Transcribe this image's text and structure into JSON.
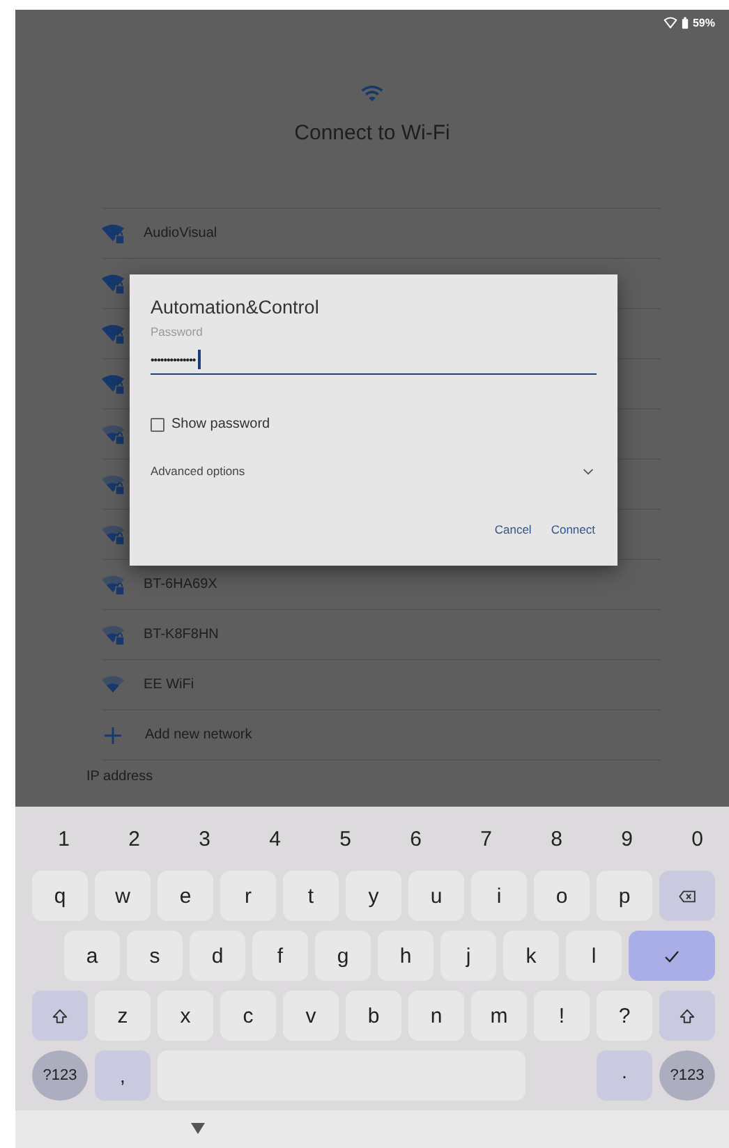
{
  "status_bar": {
    "battery": "59%"
  },
  "page": {
    "title": "Connect to Wi-Fi"
  },
  "networks": [
    {
      "name": "AudioVisual",
      "secured": true,
      "kind": "strong"
    },
    {
      "secured": true,
      "kind": "strong"
    },
    {
      "secured": true,
      "kind": "strong"
    },
    {
      "secured": true,
      "kind": "strong"
    },
    {
      "secured": true,
      "kind": "weak"
    },
    {
      "secured": true,
      "kind": "weak"
    },
    {
      "secured": true,
      "kind": "weak"
    },
    {
      "name": "BT-6HA69X",
      "secured": true,
      "kind": "weak"
    },
    {
      "name": "BT-K8F8HN",
      "secured": true,
      "kind": "weak"
    },
    {
      "name": "EE WiFi",
      "secured": false,
      "kind": "weak"
    }
  ],
  "add_network": "Add new network",
  "ip_address": "IP address",
  "dialog": {
    "title": "Automation&Control",
    "password_label": "Password",
    "password_value": "••••••••••••••",
    "show_password": {
      "label": "Show password",
      "checked": false
    },
    "advanced_options": {
      "label": "Advanced options",
      "expanded": false
    },
    "buttons": [
      "Cancel",
      "Connect"
    ]
  },
  "keyboard": {
    "number_row": [
      "1",
      "2",
      "3",
      "4",
      "5",
      "6",
      "7",
      "8",
      "9",
      "0"
    ],
    "rows": [
      [
        {
          "kind": "char",
          "label": "q"
        },
        {
          "kind": "char",
          "label": "w"
        },
        {
          "kind": "char",
          "label": "e"
        },
        {
          "kind": "char",
          "label": "r"
        },
        {
          "kind": "char",
          "label": "t"
        },
        {
          "kind": "char",
          "label": "y"
        },
        {
          "kind": "char",
          "label": "u"
        },
        {
          "kind": "char",
          "label": "i"
        },
        {
          "kind": "char",
          "label": "o"
        },
        {
          "kind": "char",
          "label": "p"
        },
        {
          "kind": "backspace"
        }
      ],
      [
        {
          "kind": "char",
          "label": "a"
        },
        {
          "kind": "char",
          "label": "s"
        },
        {
          "kind": "char",
          "label": "d"
        },
        {
          "kind": "char",
          "label": "f"
        },
        {
          "kind": "char",
          "label": "g"
        },
        {
          "kind": "char",
          "label": "h"
        },
        {
          "kind": "char",
          "label": "j"
        },
        {
          "kind": "char",
          "label": "k"
        },
        {
          "kind": "char",
          "label": "l"
        },
        {
          "kind": "enter"
        }
      ],
      [
        {
          "kind": "shift"
        },
        {
          "kind": "char",
          "label": "z"
        },
        {
          "kind": "char",
          "label": "x"
        },
        {
          "kind": "char",
          "label": "c"
        },
        {
          "kind": "char",
          "label": "v"
        },
        {
          "kind": "char",
          "label": "b"
        },
        {
          "kind": "char",
          "label": "n"
        },
        {
          "kind": "char",
          "label": "m"
        },
        {
          "kind": "char",
          "label": "!"
        },
        {
          "kind": "char",
          "label": "?"
        },
        {
          "kind": "shift"
        }
      ]
    ],
    "bottom_row": {
      "left_keys": [
        {
          "kind": "symbols",
          "label": "?123"
        },
        {
          "kind": "punct",
          "label": ","
        }
      ],
      "right_keys": [
        {
          "kind": "punct",
          "label": "·"
        },
        {
          "kind": "symbols",
          "label": "?123"
        }
      ]
    }
  }
}
